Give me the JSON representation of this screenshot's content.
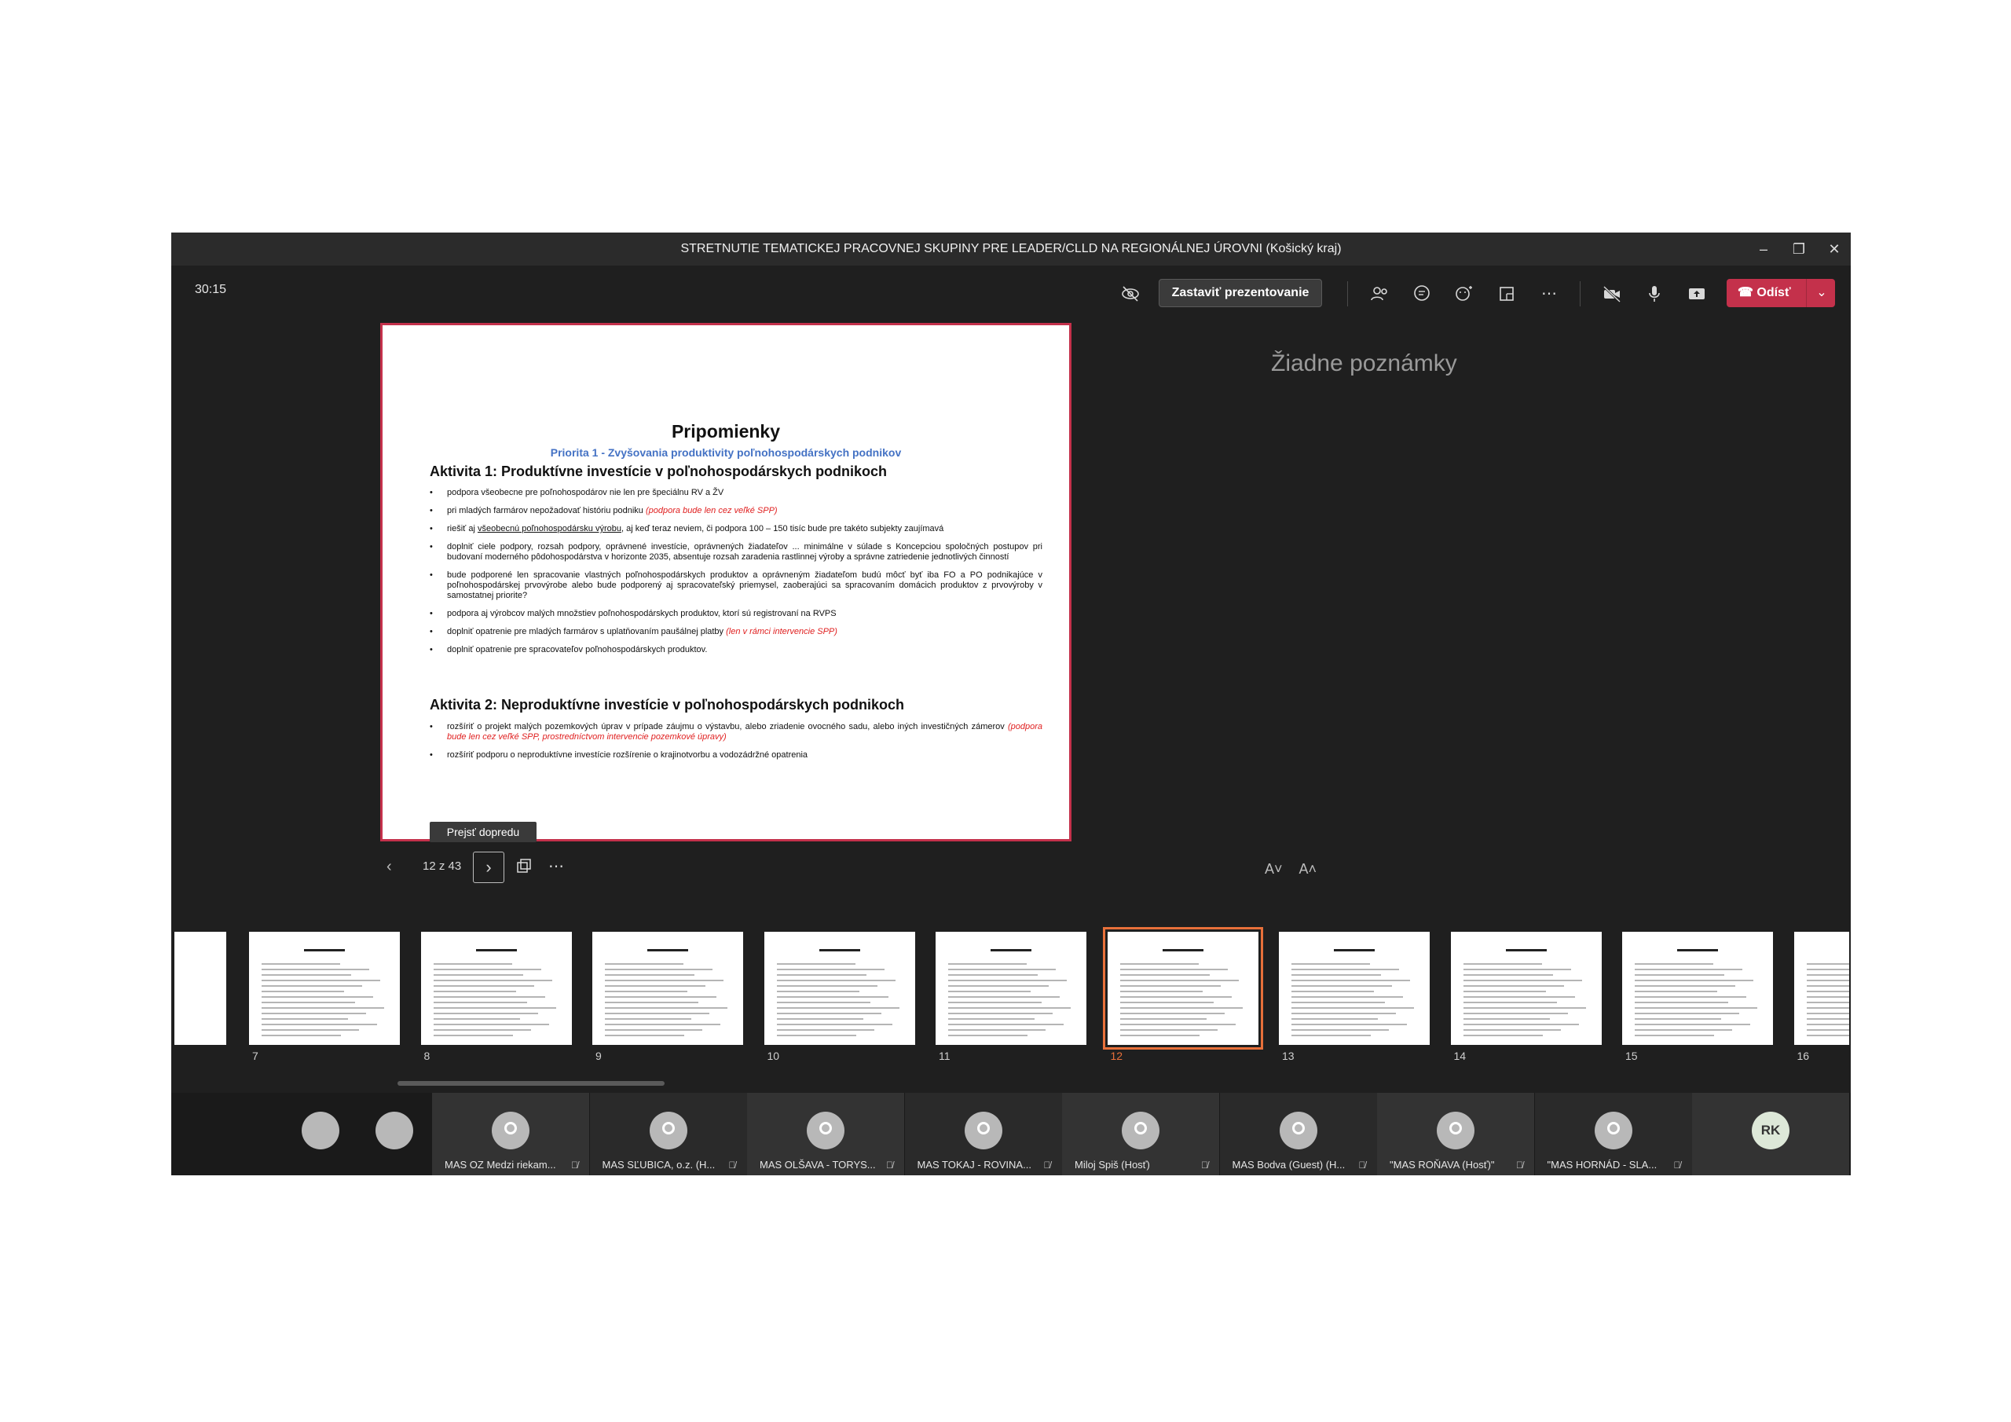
{
  "window": {
    "title": "STRETNUTIE TEMATICKEJ PRACOVNEJ SKUPINY PRE LEADER/CLLD NA REGIONÁLNEJ ÚROVNI (Košický kraj)"
  },
  "toolbar": {
    "timer": "30:15",
    "stop_presenting": "Zastaviť prezentovanie",
    "leave": "Odísť"
  },
  "slide": {
    "title": "Pripomienky",
    "subtitle": "Priorita 1 - Zvyšovania produktivity poľnohospodárskych podnikov",
    "activity1": {
      "heading": "Aktivita 1: Produktívne investície v poľnohospodárskych podnikoch",
      "b1": "podpora všeobecne pre poľnohospodárov nie len pre špeciálnu RV a ŽV",
      "b2_text": "pri mladých farmárov nepožadovať históriu podniku ",
      "b2_red": "(podpora bude len cez veľké SPP)",
      "b3_pre": "riešiť aj ",
      "b3_ul": "všeobecnú poľnohospodársku výrobu",
      "b3_post": ", aj keď teraz neviem, či podpora 100 – 150 tisíc bude pre takéto subjekty zaujímavá",
      "b4": "doplniť ciele podpory, rozsah podpory, oprávnené investície, oprávnených žiadateľov ... minimálne v súlade s Koncepciou spoločných postupov pri budovaní moderného pôdohospodárstva v horizonte 2035, absentuje rozsah zaradenia rastlinnej výroby a správne zatriedenie jednotlivých činností",
      "b5": "bude podporené len spracovanie vlastných poľnohospodárskych produktov a oprávneným žiadateľom budú môcť byť iba FO a PO podnikajúce v poľnohospodárskej prvovýrobe alebo bude podporený aj spracovateľský priemysel, zaoberajúci sa spracovaním domácich produktov z prvovýroby v samostatnej priorite?",
      "b6": "podpora aj výrobcov malých množstiev poľnohospodárskych produktov, ktorí sú registrovaní na RVPS",
      "b7_text": "doplniť opatrenie  pre mladých farmárov s uplatňovaním paušálnej platby ",
      "b7_red": "(len v rámci intervencie SPP)",
      "b8": "doplniť opatrenie  pre spracovateľov poľnohospodárskych produktov."
    },
    "activity2": {
      "heading": "Aktivita 2: Neproduktívne investície v poľnohospodárskych podnikoch",
      "b1_text": "rozšíriť o projekt malých pozemkových úprav v prípade záujmu o výstavbu, alebo zriadenie ovocného sadu, alebo iných investičných zámerov ",
      "b1_red": "(podpora bude len cez veľké SPP, prostredníctvom intervencie pozemkové úpravy)",
      "b2": "rozšíriť podporu o neproduktívne investície rozšírenie o krajinotvorbu a vodozádržné opatrenia"
    }
  },
  "tooltip": "Prejsť dopredu",
  "nav": {
    "counter": "12 z 43"
  },
  "notes": {
    "empty": "Žiadne poznámky"
  },
  "font_controls": {
    "decrease": "A˅",
    "increase": "A˄"
  },
  "thumbnails": {
    "numbers": [
      "7",
      "8",
      "9",
      "10",
      "11",
      "12",
      "13",
      "14",
      "15",
      "16"
    ],
    "selected": "12"
  },
  "participants": [
    {
      "name": "MAS OZ Medzi riekam..."
    },
    {
      "name": "MAS SĽUBICA, o.z. (H..."
    },
    {
      "name": "MAS OLŠAVA - TORYS..."
    },
    {
      "name": "MAS TOKAJ - ROVINA..."
    },
    {
      "name": "Miloj Spiš (Hosť)"
    },
    {
      "name": "MAS Bodva (Guest) (H..."
    },
    {
      "name": "\"MAS ROŇAVA (Hosť)\""
    },
    {
      "name": "\"MAS HORNÁD - SLA..."
    }
  ],
  "self_avatar": "RK"
}
